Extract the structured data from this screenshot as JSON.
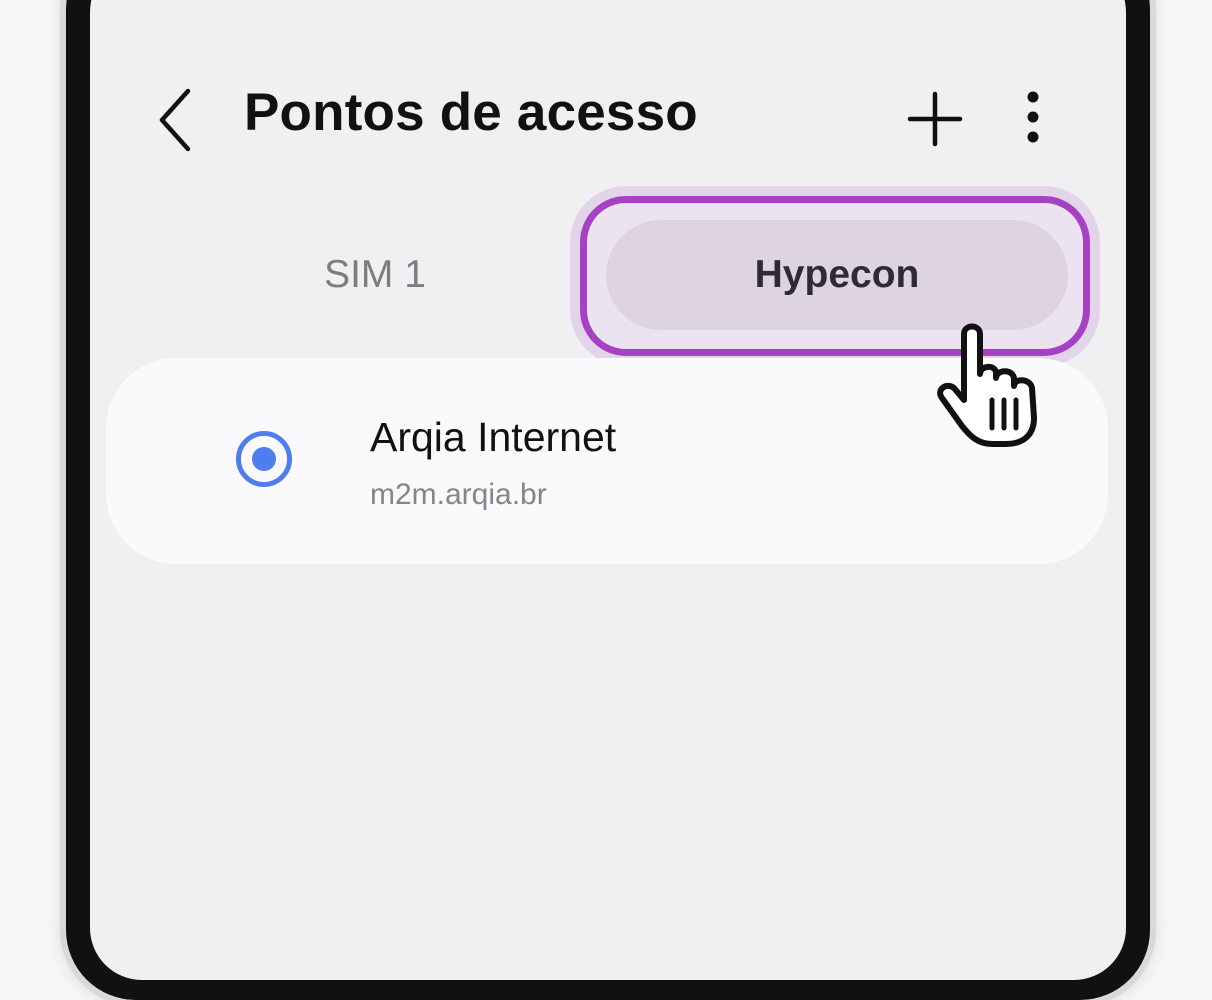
{
  "header": {
    "title": "Pontos de acesso",
    "back_icon": "chevron-left-icon",
    "add_icon": "plus-icon",
    "more_icon": "more-vertical-icon"
  },
  "tabs": [
    {
      "label": "SIM 1",
      "selected": false
    },
    {
      "label": "Hypecon",
      "selected": true
    }
  ],
  "apn_list": [
    {
      "name": "Arqia Internet",
      "apn": "m2m.arqia.br",
      "selected": true
    }
  ],
  "colors": {
    "accent": "#4e7df0",
    "highlight": "#a641c4",
    "selected_tab_bg": "#ded3e2"
  },
  "cursor_icon": "hand-pointer-icon"
}
